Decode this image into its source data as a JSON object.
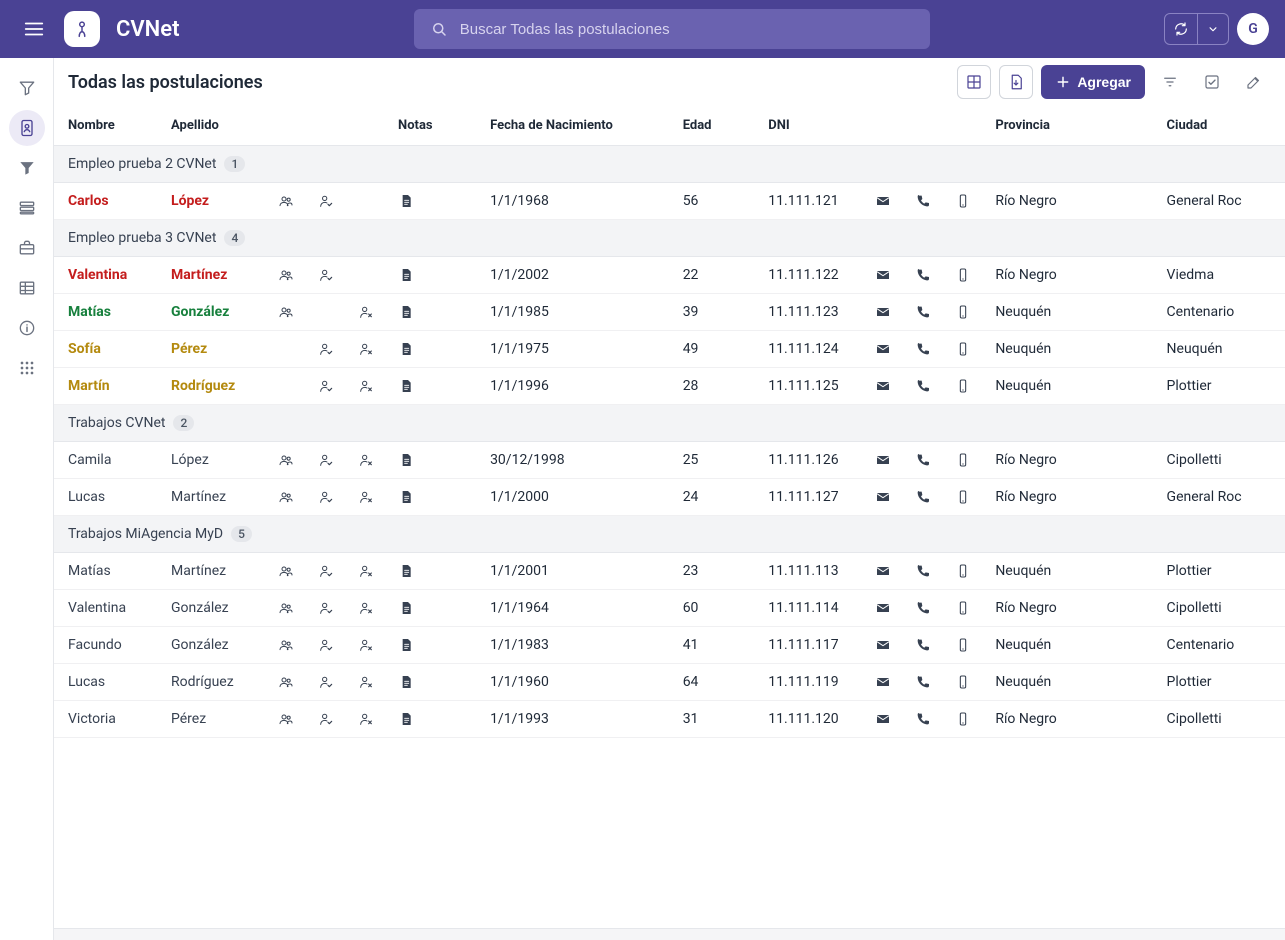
{
  "header": {
    "app_title": "CVNet",
    "search_placeholder": "Buscar Todas las postulaciones",
    "avatar_letter": "G"
  },
  "toolbar": {
    "title": "Todas las postulaciones",
    "add_label": "Agregar"
  },
  "columns": {
    "nombre": "Nombre",
    "apellido": "Apellido",
    "notas": "Notas",
    "fecha": "Fecha de Nacimiento",
    "edad": "Edad",
    "dni": "DNI",
    "provincia": "Provincia",
    "ciudad": "Ciudad"
  },
  "groups": [
    {
      "title": "Empleo prueba 2 CVNet",
      "count": "1",
      "rows": [
        {
          "color": "red",
          "nombre": "Carlos",
          "apellido": "López",
          "icons": {
            "group": true,
            "person_check": true,
            "person_x": false,
            "note": true
          },
          "fecha": "1/1/1968",
          "edad": "56",
          "dni": "11.111.121",
          "contact": {
            "mail": true,
            "phone": true,
            "mobile": true
          },
          "provincia": "Río Negro",
          "ciudad": "General Roc"
        }
      ]
    },
    {
      "title": "Empleo prueba 3 CVNet",
      "count": "4",
      "rows": [
        {
          "color": "red",
          "nombre": "Valentina",
          "apellido": "Martínez",
          "icons": {
            "group": true,
            "person_check": true,
            "person_x": false,
            "note": true
          },
          "fecha": "1/1/2002",
          "edad": "22",
          "dni": "11.111.122",
          "contact": {
            "mail": true,
            "phone": true,
            "mobile": true
          },
          "provincia": "Río Negro",
          "ciudad": "Viedma"
        },
        {
          "color": "green",
          "nombre": "Matías",
          "apellido": "González",
          "icons": {
            "group": true,
            "person_check": false,
            "person_x": true,
            "note": true
          },
          "fecha": "1/1/1985",
          "edad": "39",
          "dni": "11.111.123",
          "contact": {
            "mail": true,
            "phone": true,
            "mobile": true
          },
          "provincia": "Neuquén",
          "ciudad": "Centenario"
        },
        {
          "color": "olive",
          "nombre": "Sofía",
          "apellido": "Pérez",
          "icons": {
            "group": false,
            "person_check": true,
            "person_x": true,
            "note": true
          },
          "fecha": "1/1/1975",
          "edad": "49",
          "dni": "11.111.124",
          "contact": {
            "mail": true,
            "phone": true,
            "mobile": true
          },
          "provincia": "Neuquén",
          "ciudad": "Neuquén"
        },
        {
          "color": "olive",
          "nombre": "Martín",
          "apellido": "Rodríguez",
          "icons": {
            "group": false,
            "person_check": true,
            "person_x": true,
            "note": true
          },
          "fecha": "1/1/1996",
          "edad": "28",
          "dni": "11.111.125",
          "contact": {
            "mail": true,
            "phone": true,
            "mobile": true
          },
          "provincia": "Neuquén",
          "ciudad": "Plottier"
        }
      ]
    },
    {
      "title": "Trabajos CVNet",
      "count": "2",
      "rows": [
        {
          "color": "normal",
          "nombre": "Camila",
          "apellido": "López",
          "icons": {
            "group": true,
            "person_check": true,
            "person_x": true,
            "note": true
          },
          "fecha": "30/12/1998",
          "edad": "25",
          "dni": "11.111.126",
          "contact": {
            "mail": true,
            "phone": true,
            "mobile": true
          },
          "provincia": "Río Negro",
          "ciudad": "Cipolletti"
        },
        {
          "color": "normal",
          "nombre": "Lucas",
          "apellido": "Martínez",
          "icons": {
            "group": true,
            "person_check": true,
            "person_x": true,
            "note": true
          },
          "fecha": "1/1/2000",
          "edad": "24",
          "dni": "11.111.127",
          "contact": {
            "mail": true,
            "phone": true,
            "mobile": true
          },
          "provincia": "Río Negro",
          "ciudad": "General Roc"
        }
      ]
    },
    {
      "title": "Trabajos MiAgencia MyD",
      "count": "5",
      "rows": [
        {
          "color": "normal",
          "nombre": "Matías",
          "apellido": "Martínez",
          "icons": {
            "group": true,
            "person_check": true,
            "person_x": true,
            "note": true
          },
          "fecha": "1/1/2001",
          "edad": "23",
          "dni": "11.111.113",
          "contact": {
            "mail": true,
            "phone": true,
            "mobile": true
          },
          "provincia": "Neuquén",
          "ciudad": "Plottier"
        },
        {
          "color": "normal",
          "nombre": "Valentina",
          "apellido": "González",
          "icons": {
            "group": true,
            "person_check": true,
            "person_x": true,
            "note": true
          },
          "fecha": "1/1/1964",
          "edad": "60",
          "dni": "11.111.114",
          "contact": {
            "mail": true,
            "phone": true,
            "mobile": true
          },
          "provincia": "Río Negro",
          "ciudad": "Cipolletti"
        },
        {
          "color": "normal",
          "nombre": "Facundo",
          "apellido": "González",
          "icons": {
            "group": true,
            "person_check": true,
            "person_x": true,
            "note": true
          },
          "fecha": "1/1/1983",
          "edad": "41",
          "dni": "11.111.117",
          "contact": {
            "mail": true,
            "phone": true,
            "mobile": true
          },
          "provincia": "Neuquén",
          "ciudad": "Centenario"
        },
        {
          "color": "normal",
          "nombre": "Lucas",
          "apellido": "Rodríguez",
          "icons": {
            "group": true,
            "person_check": true,
            "person_x": true,
            "note": true
          },
          "fecha": "1/1/1960",
          "edad": "64",
          "dni": "11.111.119",
          "contact": {
            "mail": true,
            "phone": true,
            "mobile": true
          },
          "provincia": "Neuquén",
          "ciudad": "Plottier"
        },
        {
          "color": "normal",
          "nombre": "Victoria",
          "apellido": "Pérez",
          "icons": {
            "group": true,
            "person_check": true,
            "person_x": true,
            "note": true
          },
          "fecha": "1/1/1993",
          "edad": "31",
          "dni": "11.111.120",
          "contact": {
            "mail": true,
            "phone": true,
            "mobile": true
          },
          "provincia": "Río Negro",
          "ciudad": "Cipolletti"
        }
      ]
    }
  ]
}
